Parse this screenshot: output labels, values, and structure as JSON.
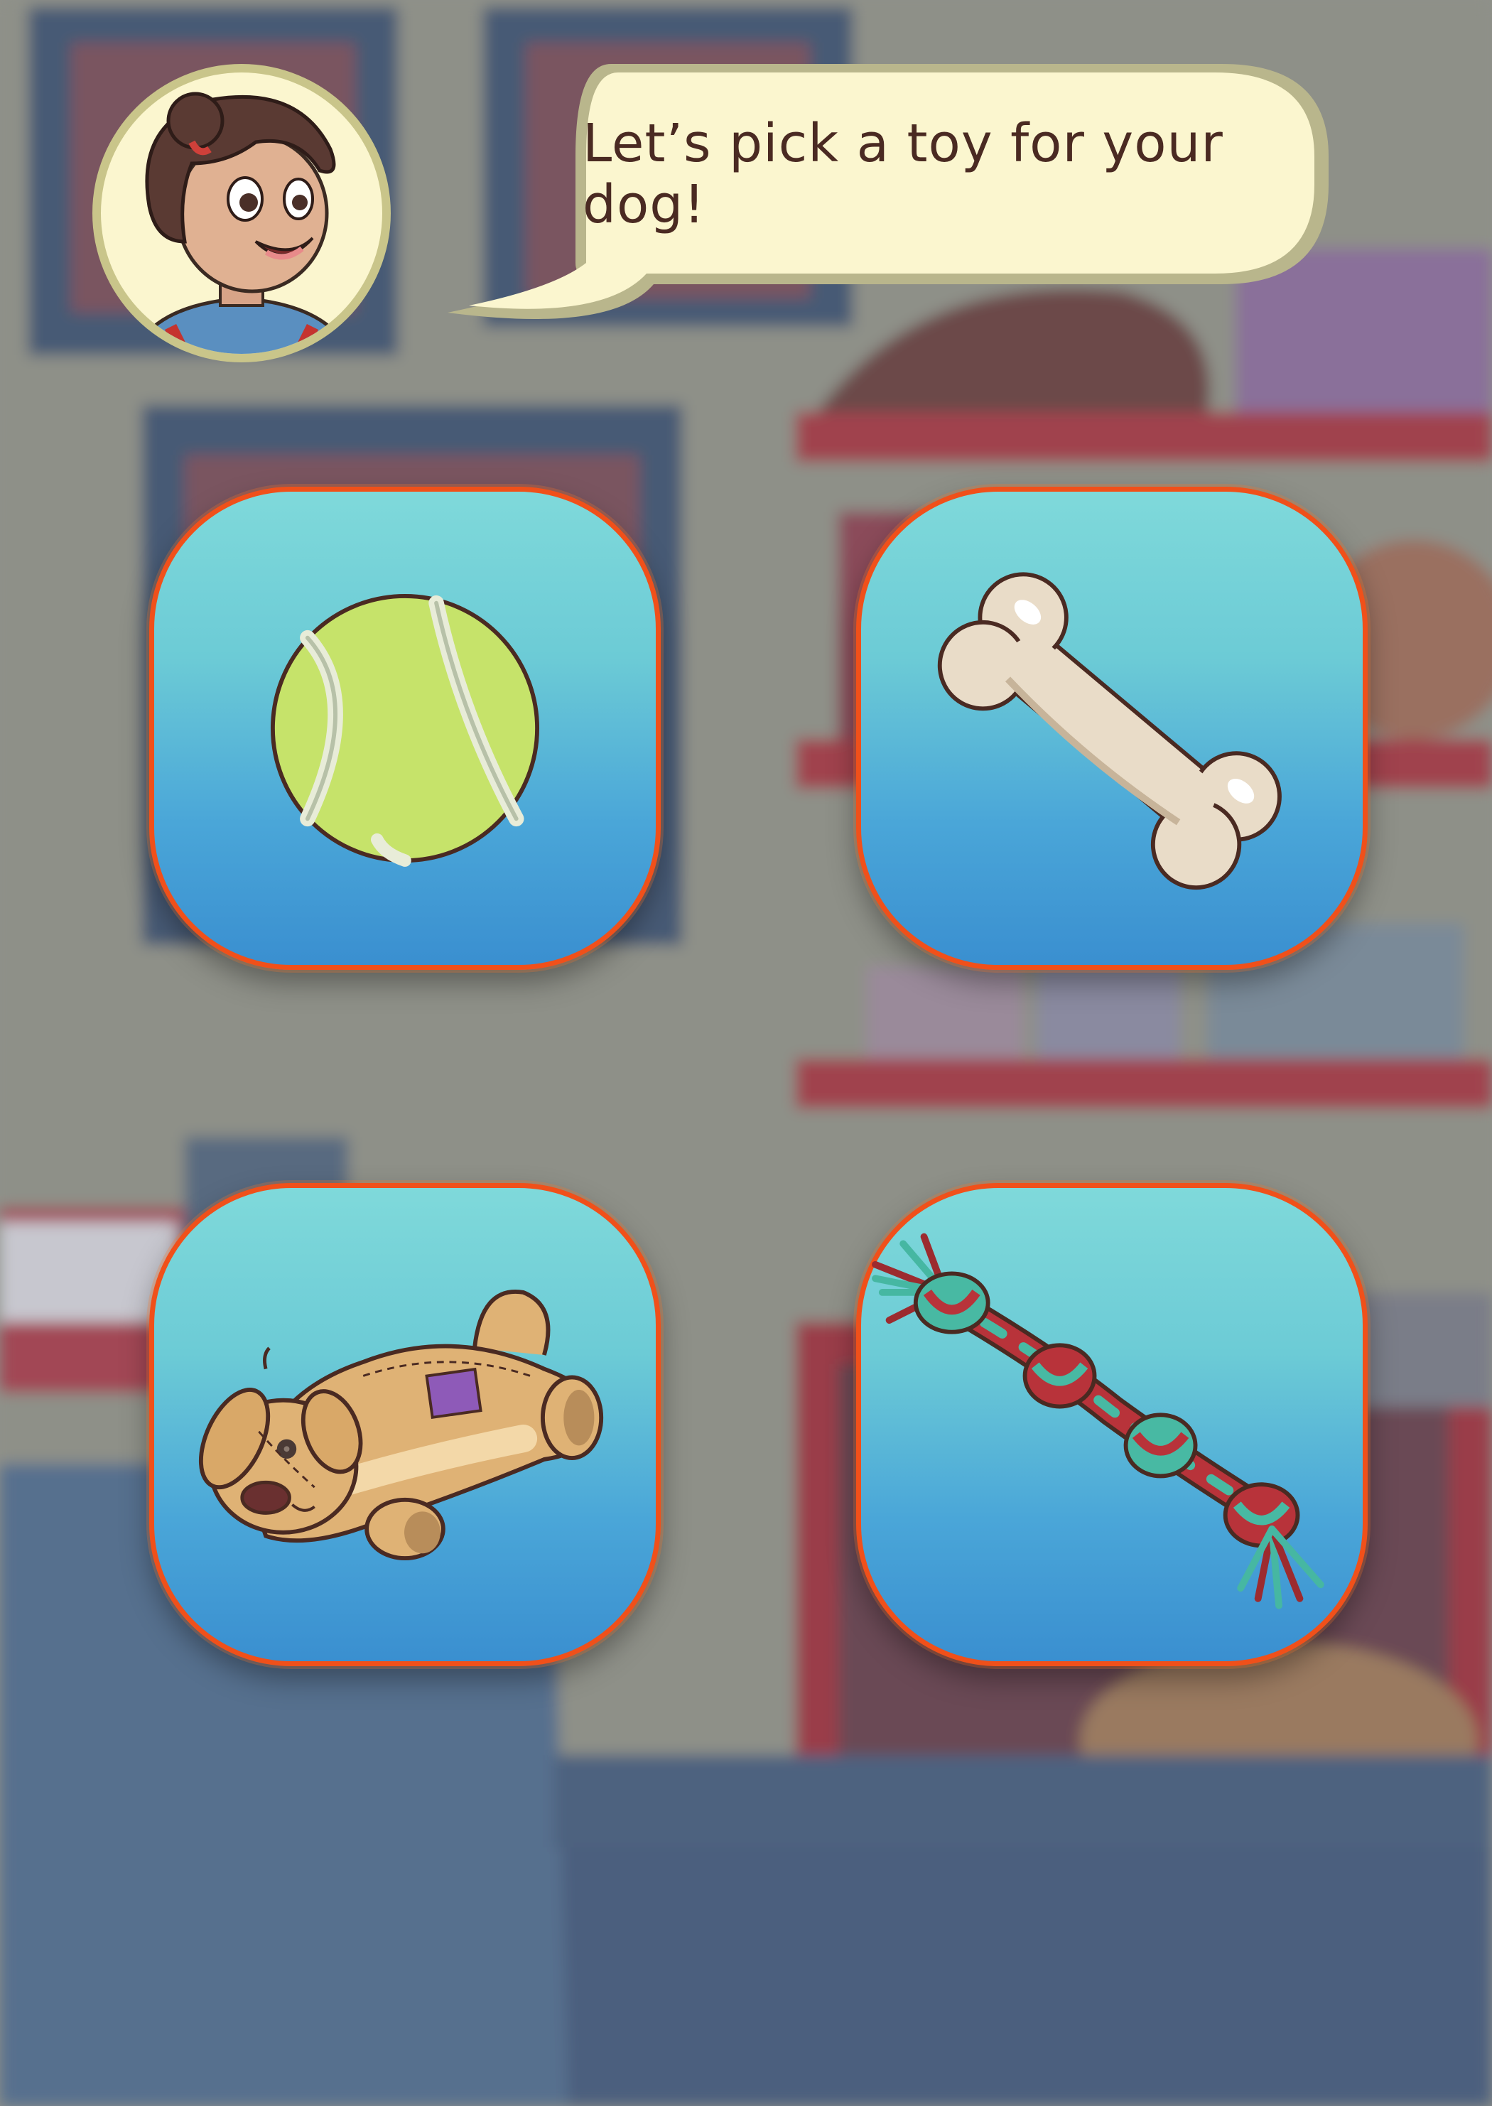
{
  "dialog": {
    "text": "Let’s pick a toy for your dog!"
  },
  "character": {
    "icon": "girl-avatar-icon"
  },
  "toys": [
    {
      "id": "ball",
      "icon": "tennis-ball-icon"
    },
    {
      "id": "bone",
      "icon": "bone-icon"
    },
    {
      "id": "plush",
      "icon": "plush-dog-icon"
    },
    {
      "id": "rope",
      "icon": "rope-toy-icon"
    }
  ],
  "colors": {
    "tile_border": "#f0501a",
    "tile_top": "#7fd9da",
    "tile_bottom": "#3a8fd0",
    "bubble_fill": "#fbf6cf",
    "bubble_stroke": "#b8b58a",
    "text": "#4a2a22"
  }
}
